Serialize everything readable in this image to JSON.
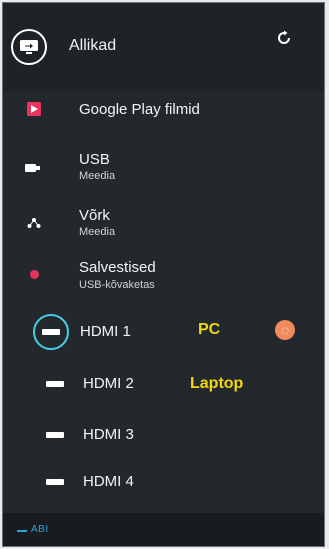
{
  "header": {
    "title": "Allikad",
    "source_icon": "input-source-icon",
    "refresh_icon": "refresh-icon"
  },
  "sources": [
    {
      "label": "Google Play filmid",
      "icon": "google-play-movies-icon"
    },
    {
      "label": "USB",
      "sublabel": "Meedia",
      "icon": "usb-icon"
    },
    {
      "label": "Võrk",
      "sublabel": "Meedia",
      "icon": "network-icon"
    },
    {
      "label": "Salvestised",
      "sublabel": "USB-kõvaketas",
      "icon": "record-dot-icon"
    },
    {
      "label": "HDMI 1",
      "icon": "hdmi-icon",
      "annotation": "PC",
      "selected": true
    },
    {
      "label": "HDMI 2",
      "icon": "hdmi-icon",
      "annotation": "Laptop"
    },
    {
      "label": "HDMI 3",
      "icon": "hdmi-icon"
    },
    {
      "label": "HDMI 4",
      "icon": "hdmi-icon"
    }
  ],
  "footer": {
    "help_label": "ABI"
  },
  "colors": {
    "accent": "#45d0e8",
    "annotation": "#f1d70d",
    "record": "#e8345c",
    "play": "#e8345c",
    "status_dot": "#f08a5d",
    "help": "#2ea6d8"
  }
}
